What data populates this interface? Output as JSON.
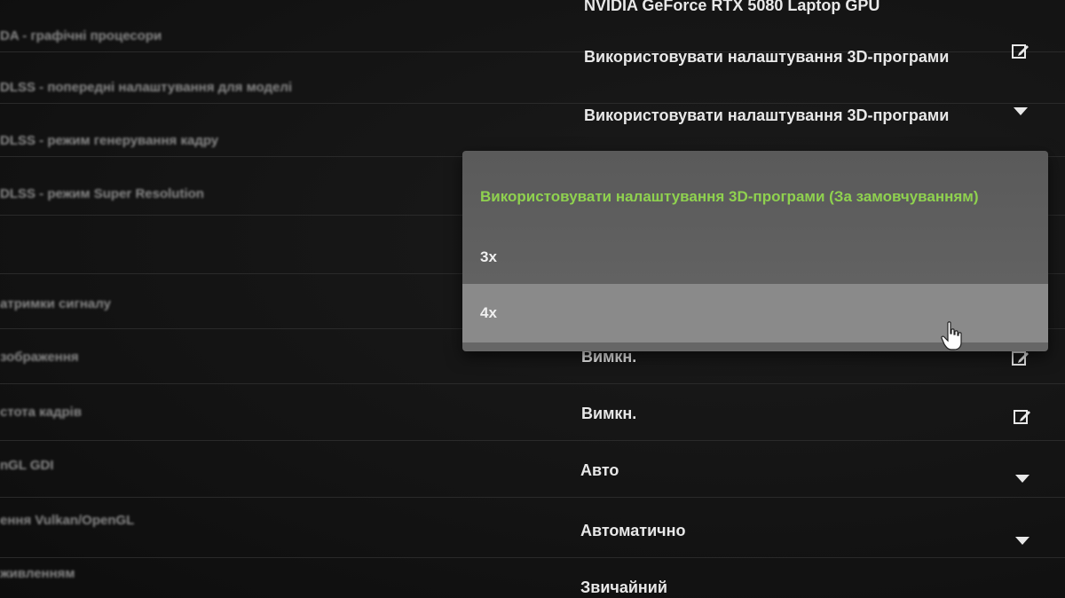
{
  "settings": {
    "rows": [
      {
        "feature": "DA - графічні процесори",
        "value": "NVIDIA GeForce RTX 5080 Laptop GPU",
        "control": "edit"
      },
      {
        "feature": "DLSS - попередні налаштування для моделі",
        "value": "Використовувати налаштування 3D-програми",
        "control": "edit"
      },
      {
        "feature": "DLSS - режим генерування кадру",
        "value": "Використовувати налаштування 3D-програми",
        "control": "dropdown"
      },
      {
        "feature": "DLSS - режим Super Resolution",
        "value": "",
        "control": "none"
      },
      {
        "feature": "атримки сигналу",
        "value": "",
        "control": "none"
      },
      {
        "feature": "зображення",
        "value": "Вимкн.",
        "control": "edit"
      },
      {
        "feature": "стота кадрів",
        "value": "Вимкн.",
        "control": "edit"
      },
      {
        "feature": "nGL GDI",
        "value": "Авто",
        "control": "dropdown"
      },
      {
        "feature": "ення Vulkan/OpenGL",
        "value": "Автоматично",
        "control": "dropdown"
      },
      {
        "feature": "живленням",
        "value": "Звичайний",
        "control": "dropdown"
      }
    ]
  },
  "dropdown": {
    "options": [
      {
        "label": "Використовувати налаштування 3D-програми (За замовчуванням)",
        "state": "selected"
      },
      {
        "label": "3x",
        "state": "normal"
      },
      {
        "label": "4x",
        "state": "hover"
      }
    ]
  },
  "colors": {
    "accent": "#8fd14f",
    "background": "#121212",
    "dropdown_bg": "#5e5e5e",
    "hover_bg": "#8a8a8a"
  },
  "icons": {
    "edit": "edit-icon",
    "dropdown": "chevron-down-icon",
    "cursor": "hand-cursor-icon"
  }
}
